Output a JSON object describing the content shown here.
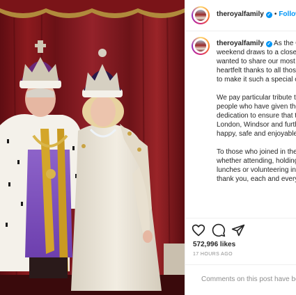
{
  "post": {
    "username": "theroyalfamily",
    "follow_label": "Follow",
    "dot": "•",
    "verified_mark": "✓",
    "caption": {
      "p1": "As the Coronation weekend draws to a close, my wife and I just wanted to share our most sincere and heartfelt thanks to all those who have helped to make it such a special occasion.",
      "p2": "We pay particular tribute to the countless people who have given their time and dedication to ensure that the celebrations in London, Windsor and further afield were happy, safe and enjoyable as possible.",
      "p3": "To those who joined in the celebrations - whether attending, holding street parties and lunches or volunteering in communities - we thank you, each and every one."
    },
    "likes": "572,996 likes",
    "timestamp": "17 HOURS AGO",
    "comments_notice": "Comments on this post have been limited."
  },
  "icons": {
    "like": "heart-icon",
    "comment": "comment-bubble-icon",
    "share": "paper-plane-icon",
    "verified": "verified-badge-icon"
  },
  "colors": {
    "link_blue": "#0095f6",
    "verified_blue": "#0095f6",
    "muted_text": "#8e8e8e",
    "backdrop_red": "#8c1a1e"
  }
}
